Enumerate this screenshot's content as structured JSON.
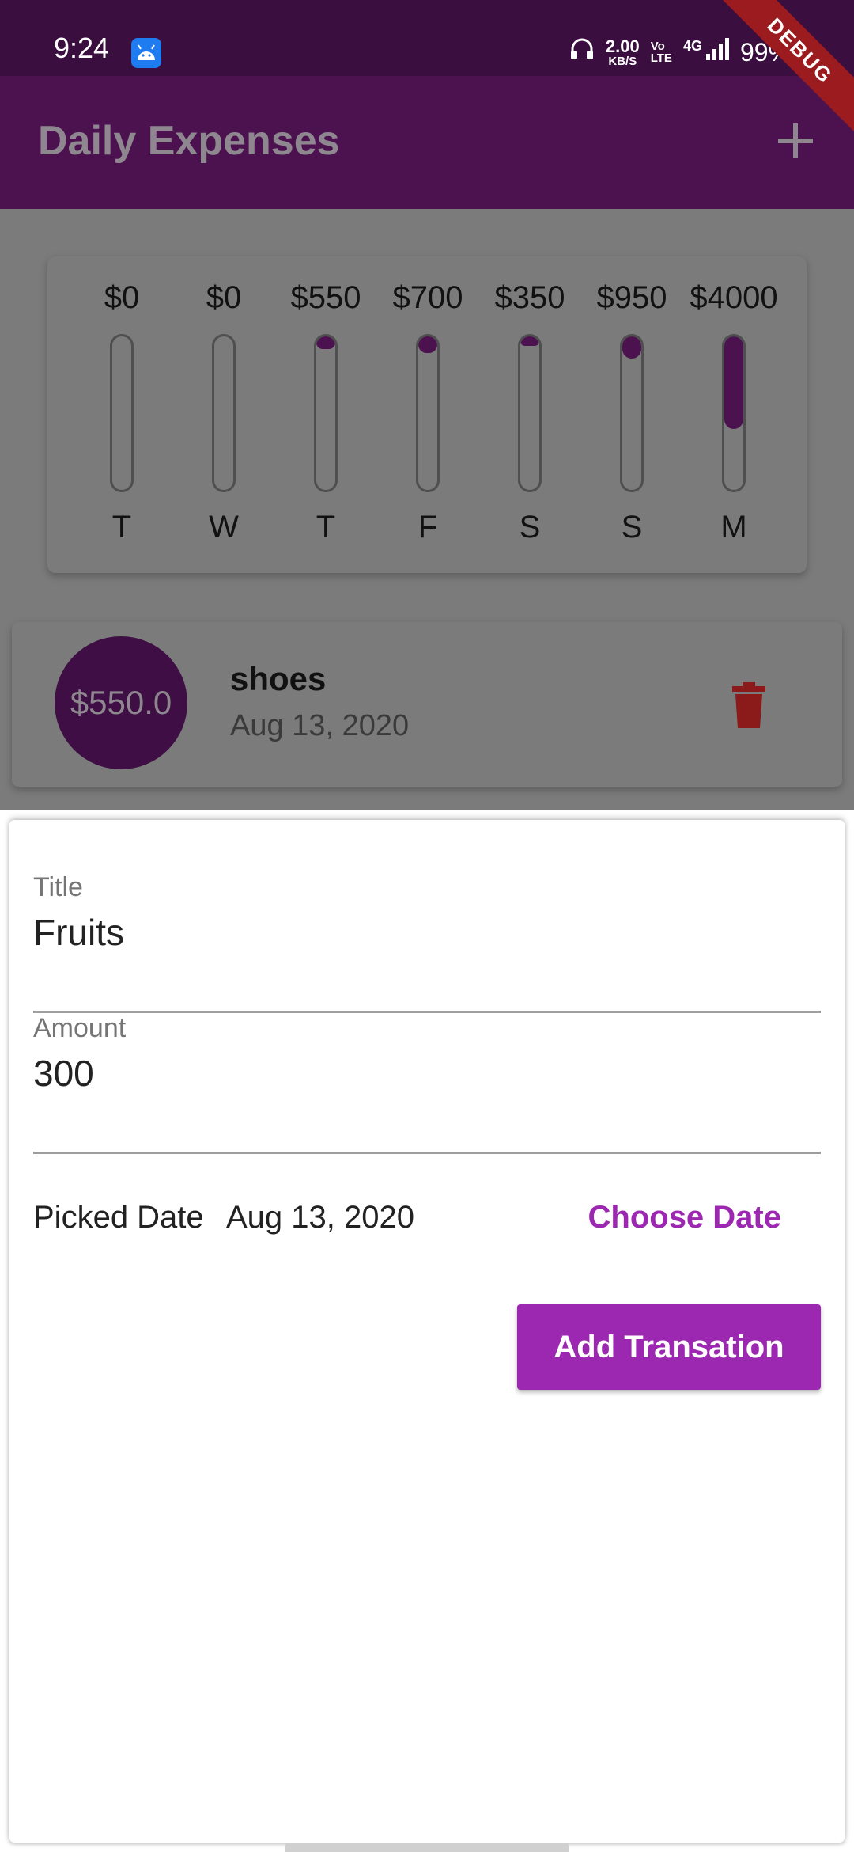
{
  "status_bar": {
    "time": "9:24",
    "net_speed_value": "2.00",
    "net_speed_unit": "KB/S",
    "volte_top": "Vo",
    "volte_bottom": "LTE",
    "network": "4G",
    "battery": "99%"
  },
  "debug_banner": "DEBUG",
  "app_bar": {
    "title": "Daily Expenses",
    "add_icon": "plus-icon"
  },
  "chart_data": {
    "type": "bar",
    "categories": [
      "T",
      "W",
      "T",
      "F",
      "S",
      "S",
      "M"
    ],
    "values": [
      0,
      0,
      550,
      700,
      350,
      950,
      4000
    ],
    "labels": [
      "$0",
      "$0",
      "$550",
      "$700",
      "$350",
      "$950",
      "$4000"
    ],
    "fill_fractions": [
      0,
      0,
      0.083,
      0.106,
      0.053,
      0.144,
      0.605
    ],
    "title": "",
    "xlabel": "",
    "ylabel": "",
    "grid": false
  },
  "transaction": {
    "amount": "$550.0",
    "title": "shoes",
    "date": "Aug 13, 2020",
    "delete_icon": "trash-icon"
  },
  "form": {
    "title_label": "Title",
    "title_value": "Fruits",
    "amount_label": "Amount",
    "amount_value": "300",
    "picked_date_label": "Picked Date",
    "picked_date_value": "Aug 13, 2020",
    "choose_date_label": "Choose Date",
    "submit_label": "Add Transation"
  },
  "colors": {
    "primary": "#9c27b0",
    "appbar": "#4c1250",
    "status_bar": "#3a0e3f",
    "danger": "#9b1b1f",
    "scrim": "#7b7b7b"
  }
}
